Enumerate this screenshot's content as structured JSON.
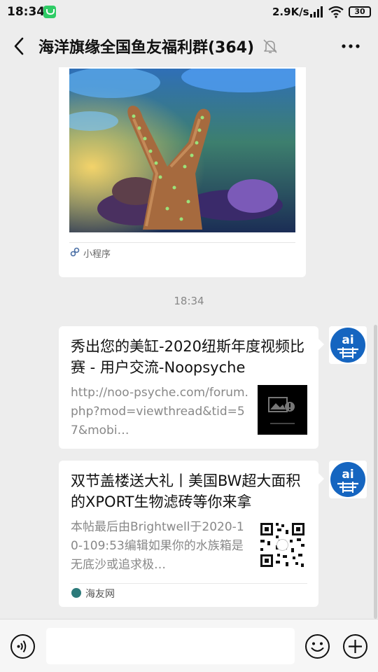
{
  "status_bar": {
    "time": "18:34",
    "network_speed": "2.9K/s",
    "battery": "30",
    "icons": [
      "app-notification-icon",
      "signal-icon",
      "wifi-icon",
      "battery-icon"
    ]
  },
  "header": {
    "title": "海洋旗缘全国鱼友福利群(364)",
    "icons": [
      "back-arrow-icon",
      "mute-bell-icon",
      "more-icon"
    ]
  },
  "messages": {
    "mini_program": {
      "label": "小程序",
      "icon": "mini-program-link-icon"
    },
    "timestamp": "18:34",
    "link_1": {
      "title": "秀出您的美缸-2020纽斯年度视频比赛 - 用户交流-Noopsyche",
      "description": "http://noo-psyche.com/forum.php?mod=viewthread&tid=57&mobi…",
      "thumb_icon": "broken-image-icon"
    },
    "link_2": {
      "title": "双节盖楼送大礼丨美国BW超大面积的XPORT生物滤砖等你来拿",
      "description": "本帖最后由Brightwell于2020-10-109:53编辑如果你的水族箱是无底沙或追求极…",
      "thumb_icon": "qr-code-icon",
      "source": "海友网",
      "source_icon": "source-logo-icon"
    },
    "sender_avatar_icon": "sender-avatar-icon"
  },
  "input_bar": {
    "value": "",
    "icons": [
      "voice-icon",
      "emoji-icon",
      "plus-icon"
    ]
  },
  "colors": {
    "background": "#ededed",
    "bubble": "#ffffff",
    "secondary_text": "#888888",
    "avatar_blue": "#1565c0"
  }
}
